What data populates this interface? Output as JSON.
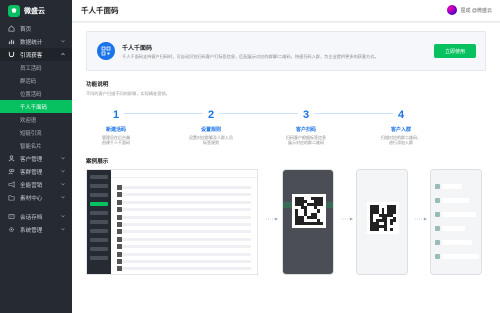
{
  "brand": {
    "name": "微盛云"
  },
  "sidebar": {
    "items": [
      {
        "label": "首页",
        "type": "item",
        "icon": "home-icon"
      },
      {
        "label": "数据统计",
        "type": "item",
        "icon": "chart-icon",
        "chevron": true
      },
      {
        "label": "引流获客",
        "type": "group-open",
        "icon": "magnet-icon",
        "chevron": true
      },
      {
        "label": "员工活码",
        "type": "sub"
      },
      {
        "label": "群活码",
        "type": "sub"
      },
      {
        "label": "位置活码",
        "type": "sub"
      },
      {
        "label": "千人千面码",
        "type": "sub",
        "active": true
      },
      {
        "label": "欢迎语",
        "type": "sub"
      },
      {
        "label": "短链引流",
        "type": "sub"
      },
      {
        "label": "智能名片",
        "type": "sub"
      },
      {
        "label": "客户管理",
        "type": "item",
        "icon": "user-icon",
        "chevron": true
      },
      {
        "label": "客群管理",
        "type": "item",
        "icon": "group-icon",
        "chevron": true
      },
      {
        "label": "全能营销",
        "type": "item",
        "icon": "megaphone-icon",
        "chevron": true
      },
      {
        "label": "素材中心",
        "type": "item",
        "icon": "folder-icon",
        "chevron": true
      },
      {
        "label": "会话存档",
        "type": "item",
        "icon": "archive-icon",
        "chevron": true
      },
      {
        "label": "系统管理",
        "type": "item",
        "icon": "gear-icon",
        "chevron": true
      }
    ]
  },
  "header": {
    "title": "千人千面码",
    "user_name": "屈成 @微盛云"
  },
  "hero": {
    "title": "千人千面码",
    "desc": "千人千面码支持客户扫码时，可自动识别扫码客户打标签信息，匹配展示对应的群聊/二维码，快速扫码入群，为企业提供更多的获客方式。",
    "button": "立即使用"
  },
  "features": {
    "title": "功能说明",
    "subtitle": "不同的客户扫描不同的群聊，实现精准营销。",
    "steps": [
      {
        "num": "1",
        "title": "新建活码",
        "desc": "管理员在后台端\n创建千人千面码"
      },
      {
        "num": "2",
        "title": "设置规则",
        "desc": "设置对应群聊及人群入员\n标签规则"
      },
      {
        "num": "3",
        "title": "客户扫码",
        "desc": "扫码客户根据标签信息\n展示对应的群二维码"
      },
      {
        "num": "4",
        "title": "客户入群",
        "desc": "扫描对应的群二维码，\n进行添加入群"
      }
    ]
  },
  "cases": {
    "title": "案例展示"
  },
  "colors": {
    "accent": "#07c160",
    "sidebar": "#262b33",
    "step": "#1a73e8"
  }
}
